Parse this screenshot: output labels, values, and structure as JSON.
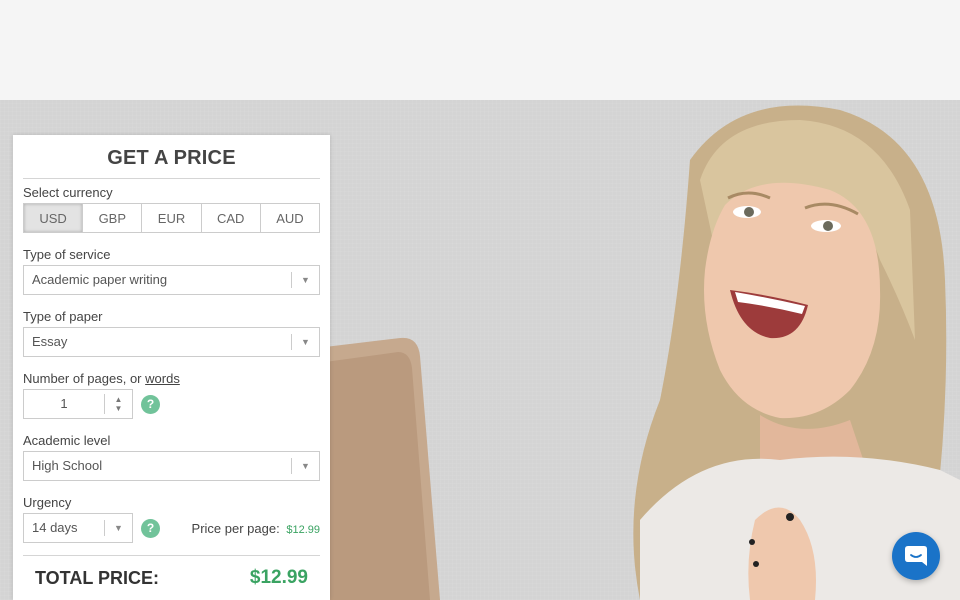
{
  "calculator": {
    "title": "GET A PRICE",
    "currency_label": "Select currency",
    "currencies": [
      "USD",
      "GBP",
      "EUR",
      "CAD",
      "AUD"
    ],
    "selected_currency": "USD",
    "service_label": "Type of service",
    "service_value": "Academic paper writing",
    "paper_label": "Type of paper",
    "paper_value": "Essay",
    "pages_label": "Number of pages, or",
    "pages_link": "words",
    "pages_value": "1",
    "level_label": "Academic level",
    "level_value": "High School",
    "urgency_label": "Urgency",
    "urgency_value": "14 days",
    "price_per_page_label": "Price per page:",
    "price_per_page_value": "$12.99",
    "help_symbol": "?",
    "total_label": "TOTAL PRICE:",
    "total_value": "$12.99"
  },
  "icons": {
    "dropdown": "chevron-down-icon",
    "stepper": "up-down-arrows-icon",
    "help": "question-icon",
    "chat": "chat-icon"
  },
  "colors": {
    "accent_green": "#3aa362",
    "help_green": "#71c39a",
    "chat_blue": "#1a73c8"
  }
}
